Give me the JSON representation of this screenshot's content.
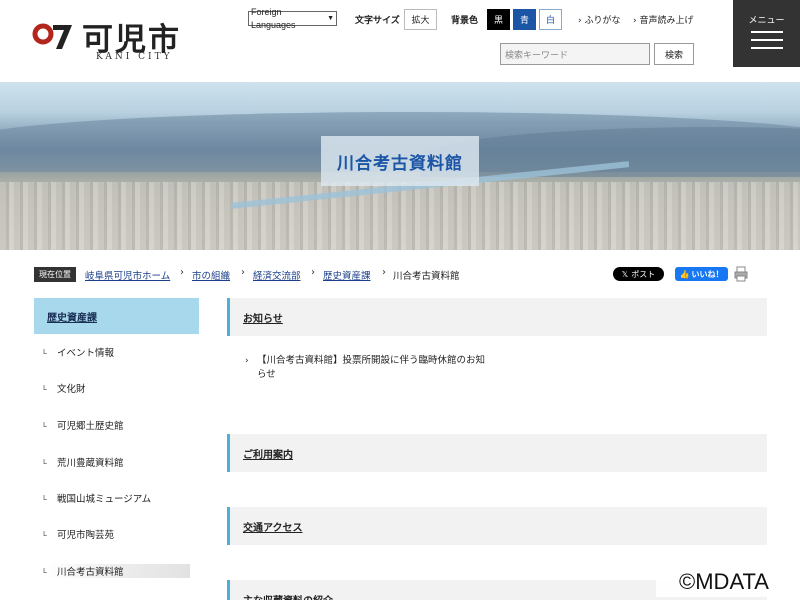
{
  "header": {
    "logo_jp": "可児市",
    "logo_en": "KANI CITY",
    "language_select": "Foreign Languages",
    "font_size_label": "文字サイズ",
    "font_size_enlarge": "拡大",
    "bg_color_label": "背景色",
    "bg_black": "黒",
    "bg_blue": "青",
    "bg_white": "白",
    "furigana": "ふりがな",
    "read_aloud": "音声読み上げ",
    "search_placeholder": "検索キーワード",
    "search_button": "検索",
    "menu_label": "メニュー"
  },
  "hero": {
    "title": "川合考古資料館"
  },
  "breadcrumb": {
    "badge": "現在位置",
    "items": [
      "岐阜県可児市ホーム",
      "市の組織",
      "経済交流部",
      "歴史資産課"
    ],
    "current": "川合考古資料館",
    "x_post": "ポスト",
    "fb_like": "いいね！"
  },
  "sidebar": {
    "heading": "歴史資産課",
    "items": [
      {
        "label": "イベント情報"
      },
      {
        "label": "文化財"
      },
      {
        "label": "可児郷土歴史館"
      },
      {
        "label": "荒川豊蔵資料館"
      },
      {
        "label": "戦国山城ミュージアム"
      },
      {
        "label": "可児市陶芸苑"
      },
      {
        "label": "川合考古資料館"
      }
    ]
  },
  "main": {
    "sections": [
      "お知らせ",
      "ご利用案内",
      "交通アクセス",
      "主な収蔵資料の紹介"
    ],
    "notice": "【川合考古資料館】投票所開設に伴う臨時休館のお知らせ"
  },
  "copyright": "©MDATA",
  "colors": {
    "accent": "#4ab0d6",
    "sidebar_head": "#a8d8ec",
    "brand_blue": "#1b55a6",
    "logo_red": "#b2261c"
  }
}
